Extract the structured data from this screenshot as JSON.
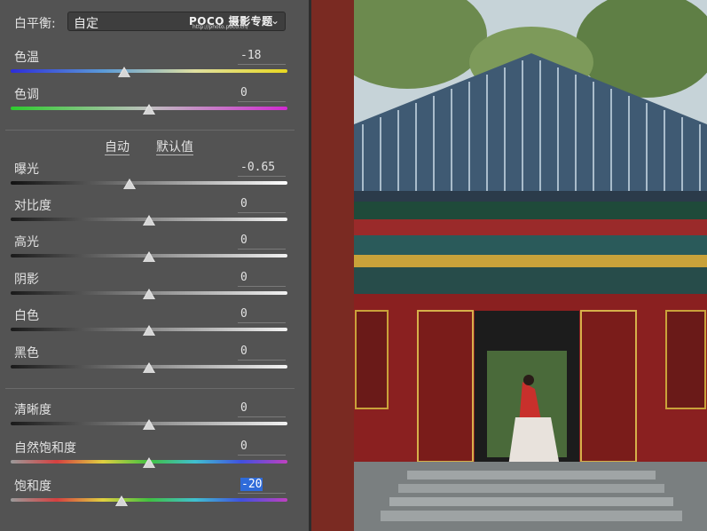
{
  "white_balance": {
    "label": "白平衡:",
    "value": "自定",
    "logo": "POCO 摄影专题",
    "logo_url": "http://photo.poco.cn/"
  },
  "sliders_top": [
    {
      "id": "temperature",
      "label": "色温",
      "value": "-18",
      "position": 0.41
    },
    {
      "id": "tint",
      "label": "色调",
      "value": "0",
      "position": 0.5
    }
  ],
  "tone_buttons": {
    "auto": "自动",
    "default": "默认值"
  },
  "sliders_tone": [
    {
      "id": "exposure",
      "label": "曝光",
      "value": "-0.65",
      "position": 0.43
    },
    {
      "id": "contrast",
      "label": "对比度",
      "value": "0",
      "position": 0.5
    },
    {
      "id": "highlights",
      "label": "高光",
      "value": "0",
      "position": 0.5
    },
    {
      "id": "shadows",
      "label": "阴影",
      "value": "0",
      "position": 0.5
    },
    {
      "id": "whites",
      "label": "白色",
      "value": "0",
      "position": 0.5
    },
    {
      "id": "blacks",
      "label": "黑色",
      "value": "0",
      "position": 0.5
    }
  ],
  "sliders_presence": [
    {
      "id": "clarity",
      "label": "清晰度",
      "value": "0",
      "position": 0.5
    },
    {
      "id": "vibrance",
      "label": "自然饱和度",
      "value": "0",
      "position": 0.5
    },
    {
      "id": "saturation",
      "label": "饱和度",
      "value": "-20",
      "position": 0.4
    }
  ],
  "colors": {
    "panel": "#535353",
    "selection": "#2f6bd9"
  }
}
